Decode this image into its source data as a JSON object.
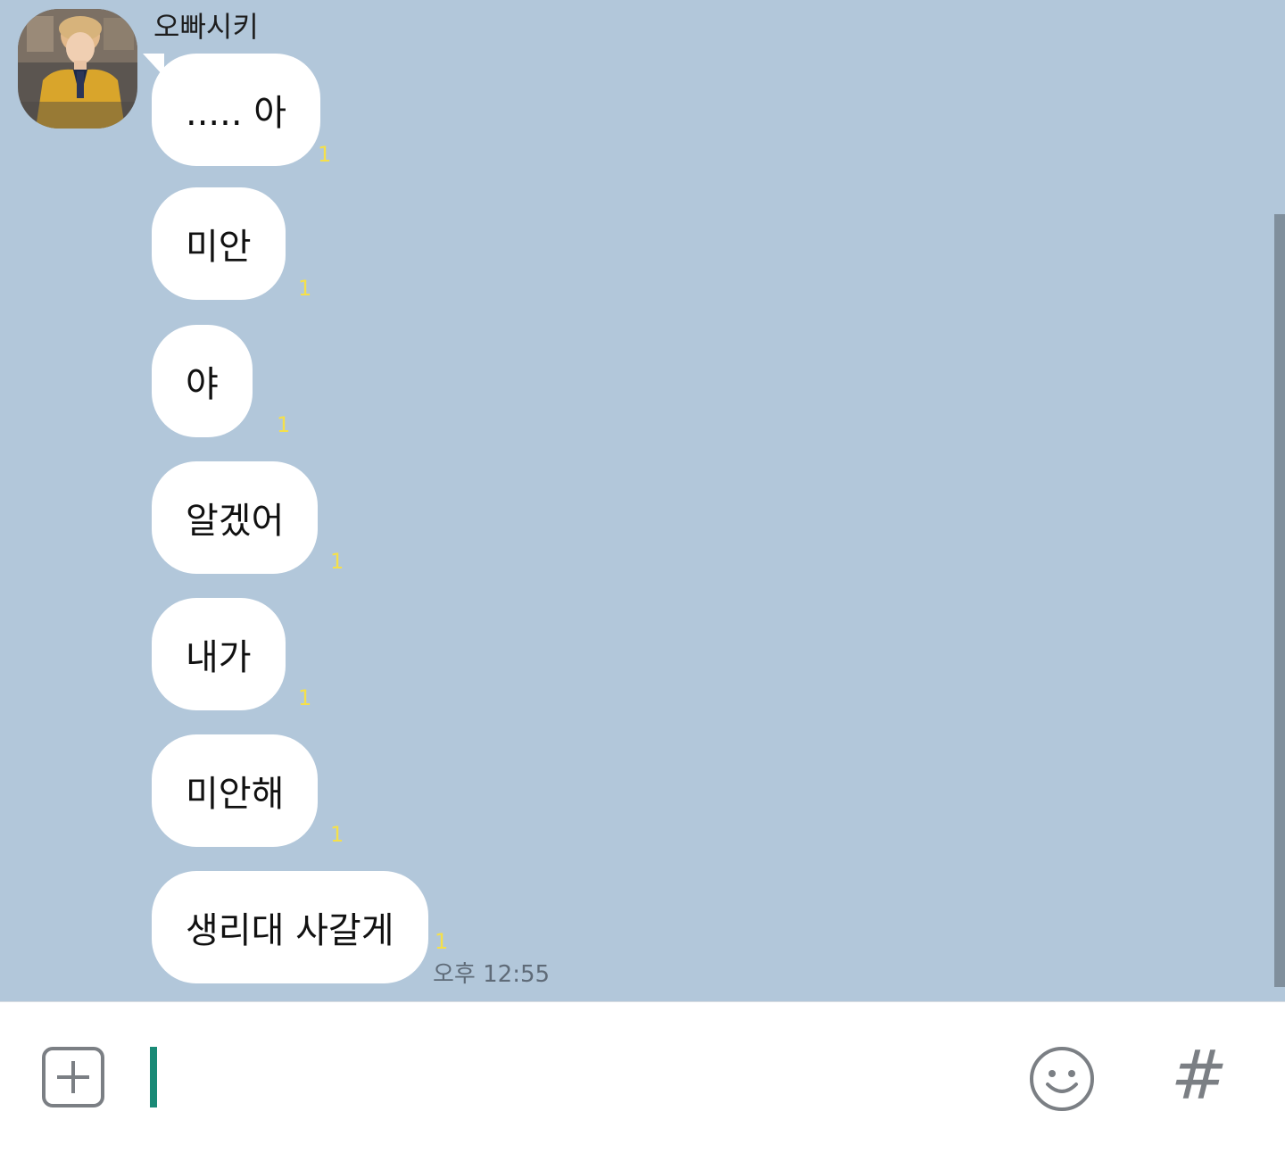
{
  "chat": {
    "sender_name": "오빠시키",
    "messages": [
      {
        "text": "..... 아",
        "read_count": "1"
      },
      {
        "text": "미안",
        "read_count": "1"
      },
      {
        "text": "야",
        "read_count": "1"
      },
      {
        "text": "알겠어",
        "read_count": "1"
      },
      {
        "text": "내가",
        "read_count": "1"
      },
      {
        "text": "미안해",
        "read_count": "1"
      },
      {
        "text": "생리대 사갈게",
        "read_count": "1"
      }
    ],
    "last_timestamp": "오후 12:55"
  },
  "input_bar": {
    "attach_icon": "plus-square-icon",
    "emoji_icon": "smiley-icon",
    "hash_label": "#",
    "message_value": ""
  },
  "colors": {
    "chat_background": "#b2c7da",
    "bubble": "#ffffff",
    "read_count": "#f5e04a",
    "cursor": "#1a8a76"
  }
}
